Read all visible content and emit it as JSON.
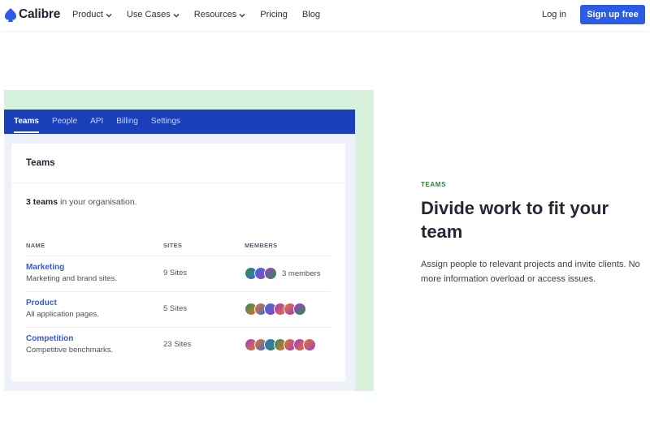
{
  "nav": {
    "brand": "Calibre",
    "links": [
      {
        "label": "Product",
        "dropdown": true
      },
      {
        "label": "Use Cases",
        "dropdown": true
      },
      {
        "label": "Resources",
        "dropdown": true
      },
      {
        "label": "Pricing",
        "dropdown": false
      },
      {
        "label": "Blog",
        "dropdown": false
      }
    ],
    "login": "Log in",
    "signup": "Sign up free",
    "brand_color": "#2d5be3"
  },
  "app": {
    "tabs": [
      "Teams",
      "People",
      "API",
      "Billing",
      "Settings"
    ],
    "active_tab": "Teams",
    "card_title": "Teams",
    "summary_count": "3 teams",
    "summary_rest": " in your organisation.",
    "columns": [
      "NAME",
      "SITES",
      "MEMBERS"
    ],
    "rows": [
      {
        "name": "Marketing",
        "desc": "Marketing and brand sites.",
        "sites": "9 Sites",
        "members_label": "3 members",
        "avatars": [
          "#2e8b57",
          "#3a6fd0",
          "#9b3fc4"
        ]
      },
      {
        "name": "Product",
        "desc": "All application pages.",
        "sites": "5 Sites",
        "members_label": "",
        "avatars": [
          "#2e8b57",
          "#e8752a",
          "#3a6fd0",
          "#9b3fc4",
          "#e8752a",
          "#9b3fc4"
        ]
      },
      {
        "name": "Competition",
        "desc": "Competitive benchmarks.",
        "sites": "23 Sites",
        "members_label": "",
        "avatars": [
          "#9b3fc4",
          "#e8752a",
          "#3a6fd0",
          "#2e8b57",
          "#e8752a",
          "#9b3fc4",
          "#e8752a"
        ]
      }
    ]
  },
  "feature": {
    "eyebrow": "TEAMS",
    "headline": "Divide work to fit your team",
    "body": "Assign people to relevant projects and invite clients. No more information overload or access issues."
  }
}
